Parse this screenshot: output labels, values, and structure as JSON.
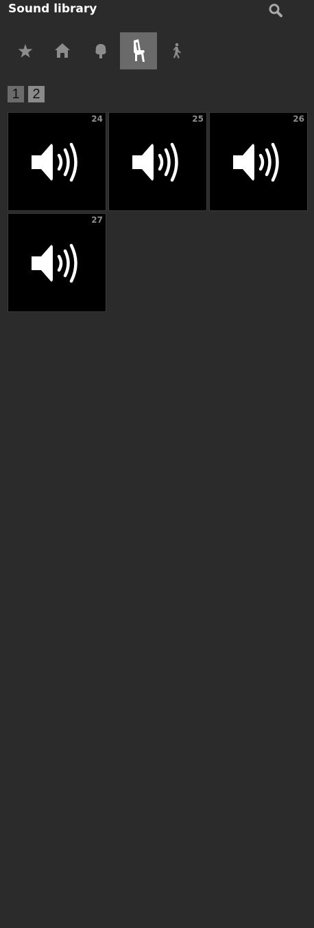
{
  "header": {
    "title": "Sound library",
    "search_icon": "search-icon"
  },
  "tabs": [
    {
      "icon": "star-icon",
      "active": false
    },
    {
      "icon": "home-icon",
      "active": false
    },
    {
      "icon": "tree-icon",
      "active": false
    },
    {
      "icon": "chair-icon",
      "active": true
    },
    {
      "icon": "walking-person-icon",
      "active": false
    }
  ],
  "pager": {
    "pages": [
      "1",
      "2"
    ],
    "current": "2"
  },
  "sounds": [
    {
      "number": "24",
      "icon": "speaker-icon"
    },
    {
      "number": "25",
      "icon": "speaker-icon"
    },
    {
      "number": "26",
      "icon": "speaker-icon"
    },
    {
      "number": "27",
      "icon": "speaker-icon"
    }
  ],
  "colors": {
    "background": "#2b2b2b",
    "active_tab": "#6a6a6a",
    "tile": "#000000",
    "icon_inactive": "#8c8c8c",
    "icon_active": "#ffffff"
  }
}
